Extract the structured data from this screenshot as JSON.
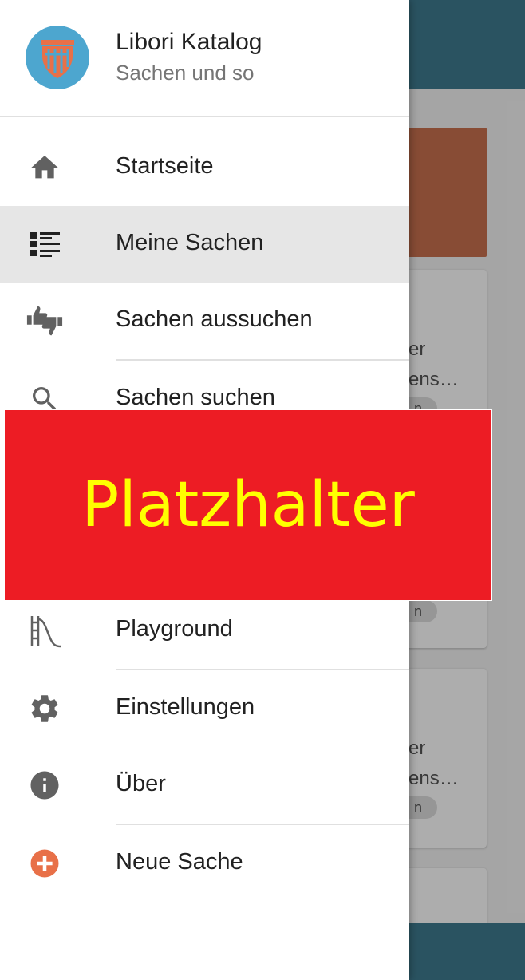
{
  "app": {
    "title": "Libori Katalog",
    "subtitle": "Sachen und so",
    "avatar_icon": "libori-logo-icon",
    "avatar_bg": "#4da6cf",
    "accent": "#e87048"
  },
  "nav": {
    "items": [
      {
        "label": "Startseite",
        "icon": "home-icon"
      },
      {
        "label": "Meine Sachen",
        "icon": "list-icon",
        "active": true
      },
      {
        "label": "Sachen aussuchen",
        "icon": "thumbs-up-down-icon"
      },
      {
        "label": "Sachen suchen",
        "icon": "search-icon"
      },
      {
        "label": "Playground",
        "icon": "slide-icon"
      },
      {
        "label": "Einstellungen",
        "icon": "gear-icon"
      },
      {
        "label": "Über",
        "icon": "info-icon"
      },
      {
        "label": "Neue Sache",
        "icon": "add-circle-icon"
      }
    ]
  },
  "placeholder": {
    "text": "Platzhalter",
    "bg": "#ed1c24",
    "color": "#ffff00"
  },
  "background": {
    "appbar_color": "#3e7b8f",
    "card_fragments": [
      "er",
      "ens…",
      "n",
      "n",
      "er",
      "ens…",
      "n"
    ]
  }
}
